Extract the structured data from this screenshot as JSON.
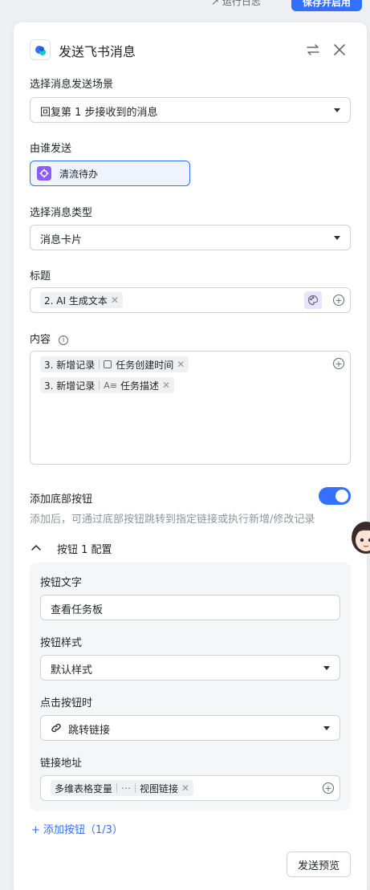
{
  "header": {
    "run_log_label": "运行日志",
    "save_button_label": "保存并启用"
  },
  "panel": {
    "title": "发送飞书消息",
    "scene": {
      "label": "选择消息发送场景",
      "value": "回复第 1 步接收到的消息"
    },
    "sender": {
      "label": "由谁发送",
      "value": "清流待办"
    },
    "msg_type": {
      "label": "选择消息类型",
      "value": "消息卡片"
    },
    "title_field": {
      "label": "标题",
      "chip": "2. AI 生成文本"
    },
    "content": {
      "label": "内容",
      "chips": [
        {
          "step": "3. 新增记录",
          "field": "任务创建时间"
        },
        {
          "step": "3. 新增记录",
          "field": "任务描述"
        }
      ]
    },
    "bottom_button": {
      "label": "添加底部按钮",
      "hint": "添加后，可通过底部按钮跳转到指定链接或执行新增/修改记录",
      "enabled": true
    },
    "button_config": {
      "title": "按钮 1 配置",
      "text_label": "按钮文字",
      "text_value": "查看任务板",
      "style_label": "按钮样式",
      "style_value": "默认样式",
      "click_label": "点击按钮时",
      "click_value": "跳转链接",
      "link_label": "链接地址",
      "link_chip_source": "多维表格变量",
      "link_chip_field": "视图链接"
    },
    "add_button_label": "+ 添加按钮（1/3）",
    "preview_button_label": "发送预览"
  },
  "colors": {
    "accent": "#3370ff",
    "sender_border": "#3370ff",
    "sender_bg": "#f0f4ff",
    "sender_icon": "#8b5cf6",
    "panel_bg": "#ffffff",
    "page_bg": "#eef0f3"
  }
}
